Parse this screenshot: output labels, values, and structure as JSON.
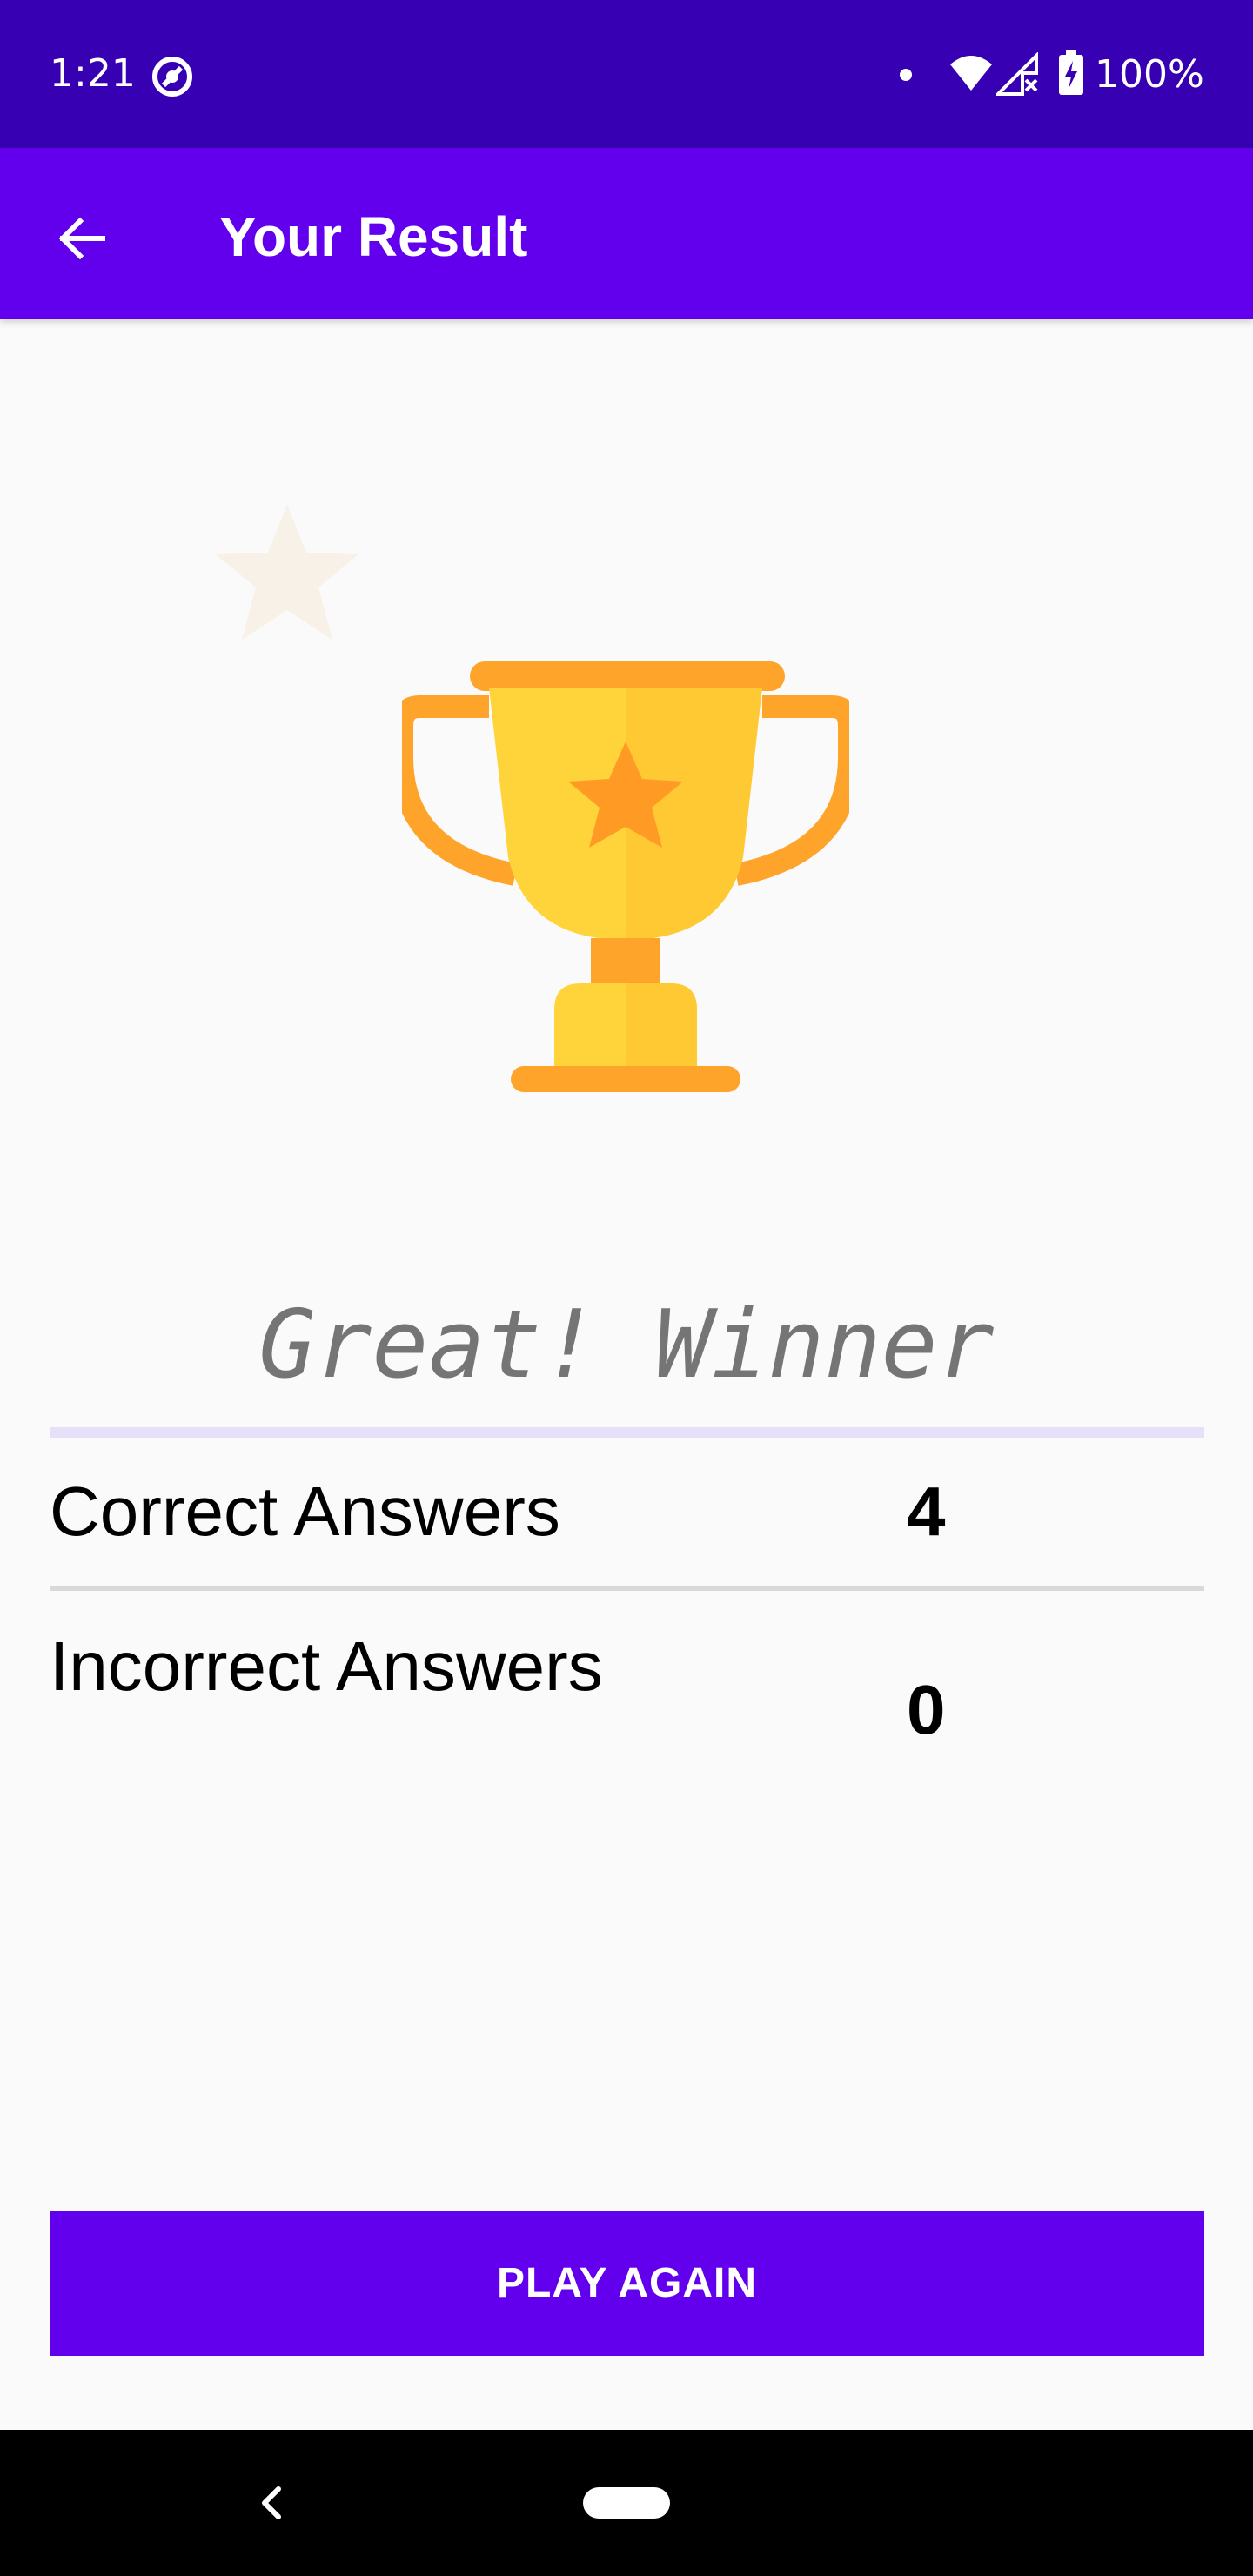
{
  "status_bar": {
    "time": "1:21",
    "battery": "100%",
    "icons": [
      "app-notification-icon",
      "dot-icon",
      "wifi-icon",
      "signal-icon",
      "battery-charging-icon"
    ]
  },
  "app_bar": {
    "title": "Your Result",
    "back_icon": "arrow-left-icon"
  },
  "illustration": {
    "trophy_icon": "trophy-icon",
    "decor_icon": "star-icon"
  },
  "result": {
    "headline": "Great! Winner",
    "correct_label": "Correct Answers",
    "correct_value": "4",
    "incorrect_label": "Incorrect Answers",
    "incorrect_value": "0"
  },
  "actions": {
    "play_again_label": "PLAY AGAIN"
  },
  "nav_bar": {
    "back_icon": "chevron-left-icon",
    "home_icon": "home-pill-icon"
  },
  "colors": {
    "primary": "#6200ee",
    "primary_dark": "#3700b3",
    "background": "#fafafa",
    "trophy_gold": "#ffd43b",
    "trophy_orange": "#ffa42b",
    "headline_gray": "#757575"
  }
}
